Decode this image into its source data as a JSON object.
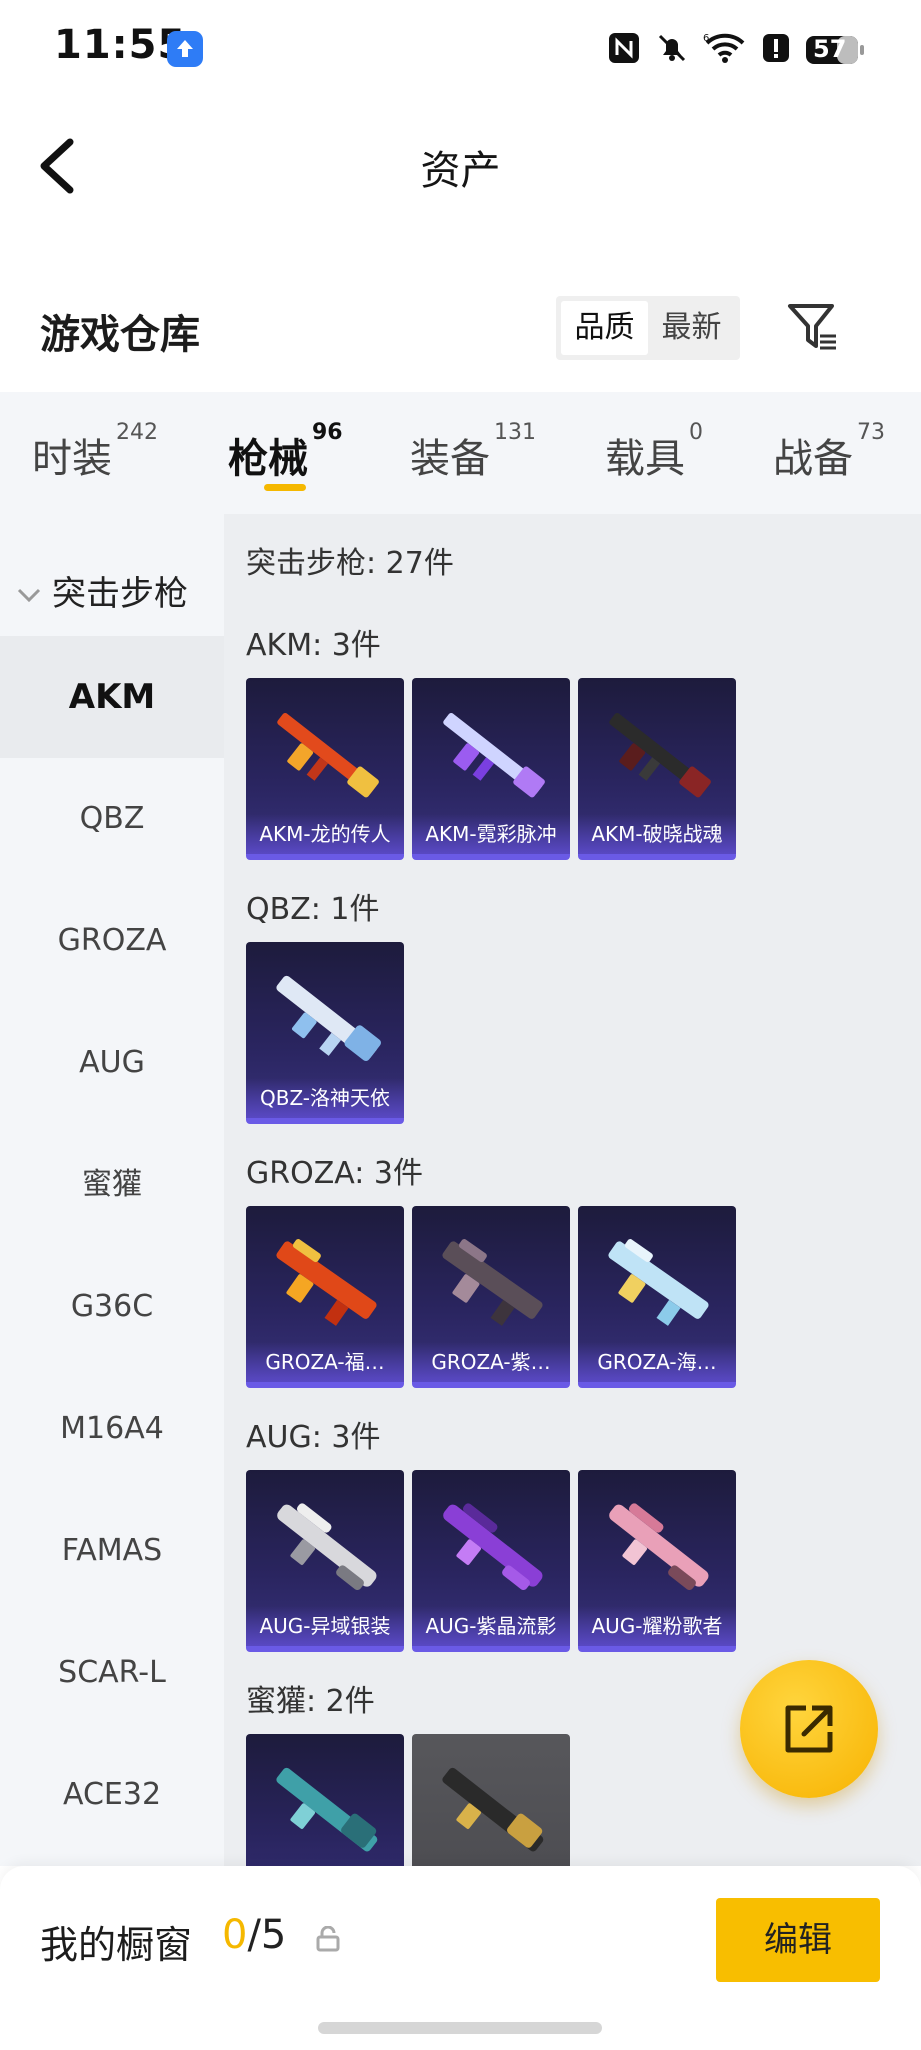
{
  "status_bar": {
    "time": "11:55",
    "battery": "57"
  },
  "header": {
    "title": "资产"
  },
  "warehouse": {
    "title": "游戏仓库",
    "sort_options": [
      "品质",
      "最新"
    ],
    "active_sort": "品质"
  },
  "tabs": [
    {
      "label": "时装",
      "count": "242"
    },
    {
      "label": "枪械",
      "count": "96"
    },
    {
      "label": "装备",
      "count": "131"
    },
    {
      "label": "载具",
      "count": "0"
    },
    {
      "label": "战备",
      "count": "73"
    }
  ],
  "active_tab": "枪械",
  "sidebar": {
    "group": "突击步枪",
    "items": [
      "AKM",
      "QBZ",
      "GROZA",
      "AUG",
      "蜜獾",
      "G36C",
      "M16A4",
      "FAMAS",
      "SCAR-L",
      "ACE32"
    ],
    "active": "AKM"
  },
  "content": {
    "group_title": "突击步枪: 27件",
    "sections": [
      {
        "title": "AKM: 3件",
        "items": [
          "AKM-龙的传人",
          "AKM-霓彩脉冲",
          "AKM-破晓战魂"
        ]
      },
      {
        "title": "QBZ: 1件",
        "items": [
          "QBZ-洛神天依"
        ]
      },
      {
        "title": "GROZA: 3件",
        "items": [
          "GROZA-福…",
          "GROZA-紫…",
          "GROZA-海…"
        ]
      },
      {
        "title": "AUG: 3件",
        "items": [
          "AUG-异域银装",
          "AUG-紫晶流影",
          "AUG-耀粉歌者"
        ]
      },
      {
        "title": "蜜獾: 2件",
        "items": [
          "",
          ""
        ]
      }
    ]
  },
  "bottom_bar": {
    "title": "我的橱窗",
    "count_current": "0",
    "count_sep_total": "/5",
    "edit_label": "编辑"
  },
  "colors": {
    "accent": "#f5b800",
    "card_bg": "#2a2560",
    "card_border": "#6a5ae6"
  },
  "icons": [
    "upload-notification-icon",
    "nfc-icon",
    "mute-icon",
    "wifi-icon",
    "alert-icon",
    "battery-icon",
    "back-arrow-icon",
    "filter-icon",
    "chevron-down-icon",
    "share-export-icon",
    "lock-icon"
  ]
}
